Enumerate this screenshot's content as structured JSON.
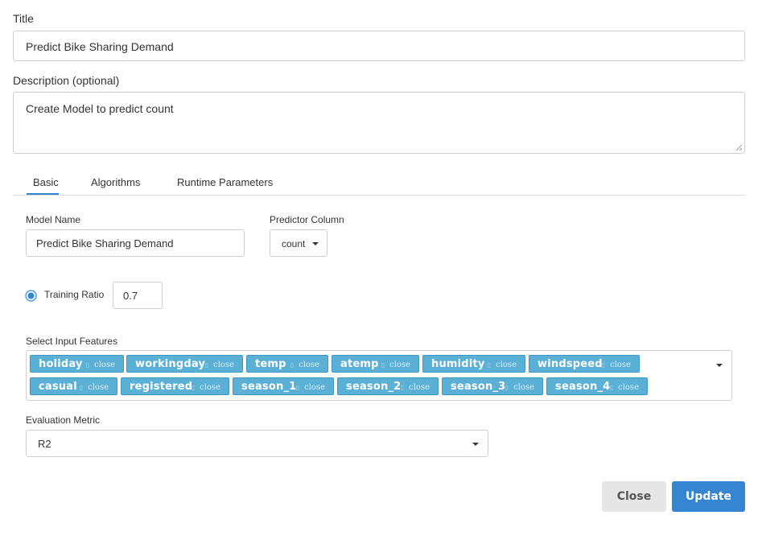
{
  "form": {
    "title_label": "Title",
    "title_value": "Predict Bike Sharing Demand",
    "description_label": "Description (optional)",
    "description_value": "Create Model to predict count"
  },
  "tabs": [
    {
      "label": "Basic",
      "active": true
    },
    {
      "label": "Algorithms",
      "active": false
    },
    {
      "label": "Runtime Parameters",
      "active": false
    }
  ],
  "basic": {
    "model_name_label": "Model Name",
    "model_name_value": "Predict Bike Sharing Demand",
    "predictor_label": "Predictor Column",
    "predictor_value": "count",
    "training_ratio_label": "Training Ratio",
    "training_ratio_value": "0.7",
    "training_ratio_selected": true,
    "features_label": "Select Input Features",
    "features": [
      {
        "label": "holiday",
        "close": "close"
      },
      {
        "label": "workingday",
        "close": "close"
      },
      {
        "label": "temp",
        "close": "close"
      },
      {
        "label": "atemp",
        "close": "close"
      },
      {
        "label": "humidity",
        "close": "close"
      },
      {
        "label": "windspeed",
        "close": "close"
      },
      {
        "label": "casual",
        "close": "close"
      },
      {
        "label": "registered",
        "close": "close"
      },
      {
        "label": "season_1",
        "close": "close"
      },
      {
        "label": "season_2",
        "close": "close"
      },
      {
        "label": "season_3",
        "close": "close"
      },
      {
        "label": "season_4",
        "close": "close"
      }
    ],
    "metric_label": "Evaluation Metric",
    "metric_value": "R2"
  },
  "actions": {
    "close_label": "Close",
    "update_label": "Update"
  },
  "colors": {
    "accent": "#2f86d0",
    "chip_bg": "#5bb0d6",
    "update_bg": "#3585d0",
    "close_bg": "#e6e6e6"
  }
}
